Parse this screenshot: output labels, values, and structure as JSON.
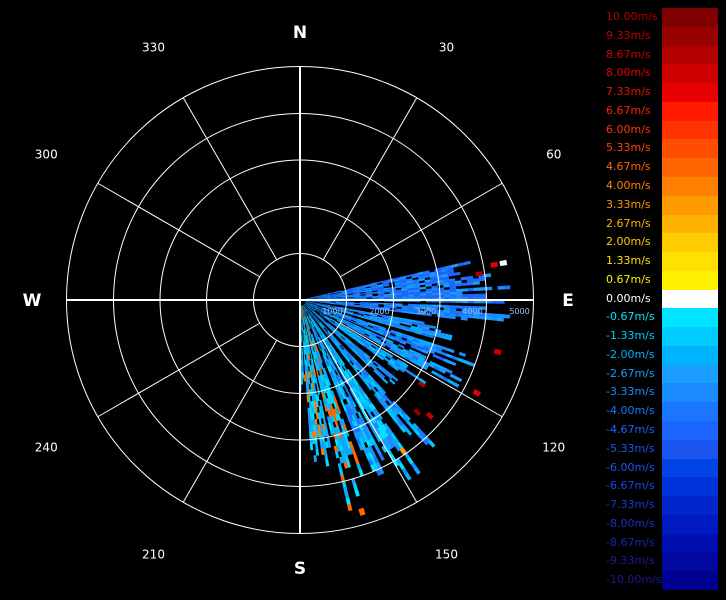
{
  "radar": {
    "cardinals": [
      {
        "label": "N",
        "deg": 0
      },
      {
        "label": "E",
        "deg": 90
      },
      {
        "label": "S",
        "deg": 180
      },
      {
        "label": "W",
        "deg": 270
      }
    ],
    "bearings": [
      {
        "label": "30",
        "deg": 30
      },
      {
        "label": "60",
        "deg": 60
      },
      {
        "label": "120",
        "deg": 120
      },
      {
        "label": "150",
        "deg": 150
      },
      {
        "label": "210",
        "deg": 210
      },
      {
        "label": "240",
        "deg": 240
      },
      {
        "label": "300",
        "deg": 300
      },
      {
        "label": "330",
        "deg": 330
      }
    ],
    "range_labels": [
      "1000",
      "2000",
      "3000",
      "4000",
      "5000"
    ],
    "max_range": 5000,
    "sectors": [
      {
        "from": 77,
        "to": 91,
        "reach": 0.88,
        "palette": [
          22,
          22,
          21,
          20,
          19,
          20
        ]
      },
      {
        "from": 92,
        "to": 97,
        "reach": 0.95,
        "palette": [
          21,
          20,
          19,
          20,
          21
        ]
      },
      {
        "from": 100,
        "to": 106,
        "reach": 0.72,
        "palette": [
          20,
          19,
          18,
          20,
          21
        ]
      },
      {
        "from": 108,
        "to": 113,
        "reach": 0.86,
        "palette": [
          19,
          20,
          18,
          21,
          22
        ]
      },
      {
        "from": 114,
        "to": 119,
        "reach": 0.78,
        "palette": [
          19,
          18,
          20,
          21
        ]
      },
      {
        "from": 121,
        "to": 126,
        "reach": 0.66,
        "palette": [
          18,
          19,
          17,
          20,
          21
        ]
      },
      {
        "from": 129,
        "to": 134,
        "reach": 0.6,
        "palette": [
          18,
          19,
          20,
          21
        ]
      },
      {
        "from": 137,
        "to": 142,
        "reach": 0.84,
        "palette": [
          17,
          18,
          19,
          20,
          21
        ]
      },
      {
        "from": 145,
        "to": 151,
        "reach": 0.98,
        "palette": [
          16,
          17,
          18,
          19,
          20
        ]
      },
      {
        "from": 152,
        "to": 158,
        "reach": 0.92,
        "palette": [
          16,
          17,
          18,
          19,
          20,
          21
        ]
      },
      {
        "from": 160,
        "to": 167,
        "reach": 0.93,
        "palette": [
          16,
          17,
          18,
          19,
          8
        ]
      },
      {
        "from": 168,
        "to": 176,
        "reach": 0.8,
        "palette": [
          17,
          18,
          19,
          9,
          16
        ]
      },
      {
        "from": 177,
        "to": 180,
        "reach": 0.45,
        "palette": [
          16,
          17,
          21
        ]
      }
    ],
    "hot_cells": [
      {
        "deg": 79,
        "r": 0.83,
        "color_index": 4
      },
      {
        "deg": 81,
        "r": 0.76,
        "color_index": 2
      },
      {
        "deg": 104,
        "r": 0.86,
        "color_index": 3
      },
      {
        "deg": 117,
        "r": 0.84,
        "color_index": 4
      },
      {
        "deg": 124,
        "r": 0.62,
        "color_index": 2
      },
      {
        "deg": 131,
        "r": 0.73,
        "color_index": 3
      },
      {
        "deg": 133,
        "r": 0.68,
        "color_index": 1
      },
      {
        "deg": 145,
        "r": 0.77,
        "color_index": 10
      },
      {
        "deg": 163,
        "r": 0.93,
        "color_index": 8
      },
      {
        "deg": 171,
        "r": 0.45,
        "color_index": 9
      },
      {
        "deg": 176,
        "r": 0.32,
        "color_index": 8
      },
      {
        "deg": 79,
        "r": 0.87,
        "color_index": 15
      }
    ]
  },
  "legend": {
    "entries": [
      {
        "label": "10.00m/s",
        "color": "#800000",
        "text_color": "#b00000"
      },
      {
        "label": "9.33m/s",
        "color": "#990000",
        "text_color": "#c00000"
      },
      {
        "label": "8.67m/s",
        "color": "#b30000",
        "text_color": "#cc0000"
      },
      {
        "label": "8.00m/s",
        "color": "#cc0000",
        "text_color": "#dd0000"
      },
      {
        "label": "7.33m/s",
        "color": "#e60000",
        "text_color": "#ee1100"
      },
      {
        "label": "6.67m/s",
        "color": "#ff1a00",
        "text_color": "#ff2200"
      },
      {
        "label": "6.00m/s",
        "color": "#ff3300",
        "text_color": "#ff3300"
      },
      {
        "label": "5.33m/s",
        "color": "#ff4d00",
        "text_color": "#ff4400"
      },
      {
        "label": "4.67m/s",
        "color": "#ff6600",
        "text_color": "#ff6600"
      },
      {
        "label": "4.00m/s",
        "color": "#ff8000",
        "text_color": "#ff8000"
      },
      {
        "label": "3.33m/s",
        "color": "#ff9900",
        "text_color": "#ff9900"
      },
      {
        "label": "2.67m/s",
        "color": "#ffb300",
        "text_color": "#ffb300"
      },
      {
        "label": "2.00m/s",
        "color": "#ffcc00",
        "text_color": "#ffcc00"
      },
      {
        "label": "1.33m/s",
        "color": "#ffe000",
        "text_color": "#ffe000"
      },
      {
        "label": "0.67m/s",
        "color": "#fff000",
        "text_color": "#fff000"
      },
      {
        "label": "0.00m/s",
        "color": "#ffffff",
        "text_color": "#ffffff"
      },
      {
        "label": "-0.67m/s",
        "color": "#00e5ff",
        "text_color": "#00e5ff"
      },
      {
        "label": "-1.33m/s",
        "color": "#00ccff",
        "text_color": "#00ccff"
      },
      {
        "label": "-2.00m/s",
        "color": "#00b3ff",
        "text_color": "#00b3ff"
      },
      {
        "label": "-2.67m/s",
        "color": "#1a9eff",
        "text_color": "#1a9eff"
      },
      {
        "label": "-3.33m/s",
        "color": "#1a8cff",
        "text_color": "#1a8cff"
      },
      {
        "label": "-4.00m/s",
        "color": "#1a75ff",
        "text_color": "#1a75ff"
      },
      {
        "label": "-4.67m/s",
        "color": "#1a66ff",
        "text_color": "#1a66ff"
      },
      {
        "label": "-5.33m/s",
        "color": "#1a55f0",
        "text_color": "#1a55f0"
      },
      {
        "label": "-6.00m/s",
        "color": "#0044e6",
        "text_color": "#1a55f0"
      },
      {
        "label": "-6.67m/s",
        "color": "#0033d9",
        "text_color": "#1a44e6"
      },
      {
        "label": "-7.33m/s",
        "color": "#0026cc",
        "text_color": "#1a3acc"
      },
      {
        "label": "-8.00m/s",
        "color": "#001abf",
        "text_color": "#1a30c0"
      },
      {
        "label": "-8.67m/s",
        "color": "#0010b0",
        "text_color": "#1a26b0"
      },
      {
        "label": "-9.33m/s",
        "color": "#0008a0",
        "text_color": "#1a1ca0"
      },
      {
        "label": "-10.00m/s",
        "color": "#000090",
        "text_color": "#1a1890"
      }
    ]
  }
}
